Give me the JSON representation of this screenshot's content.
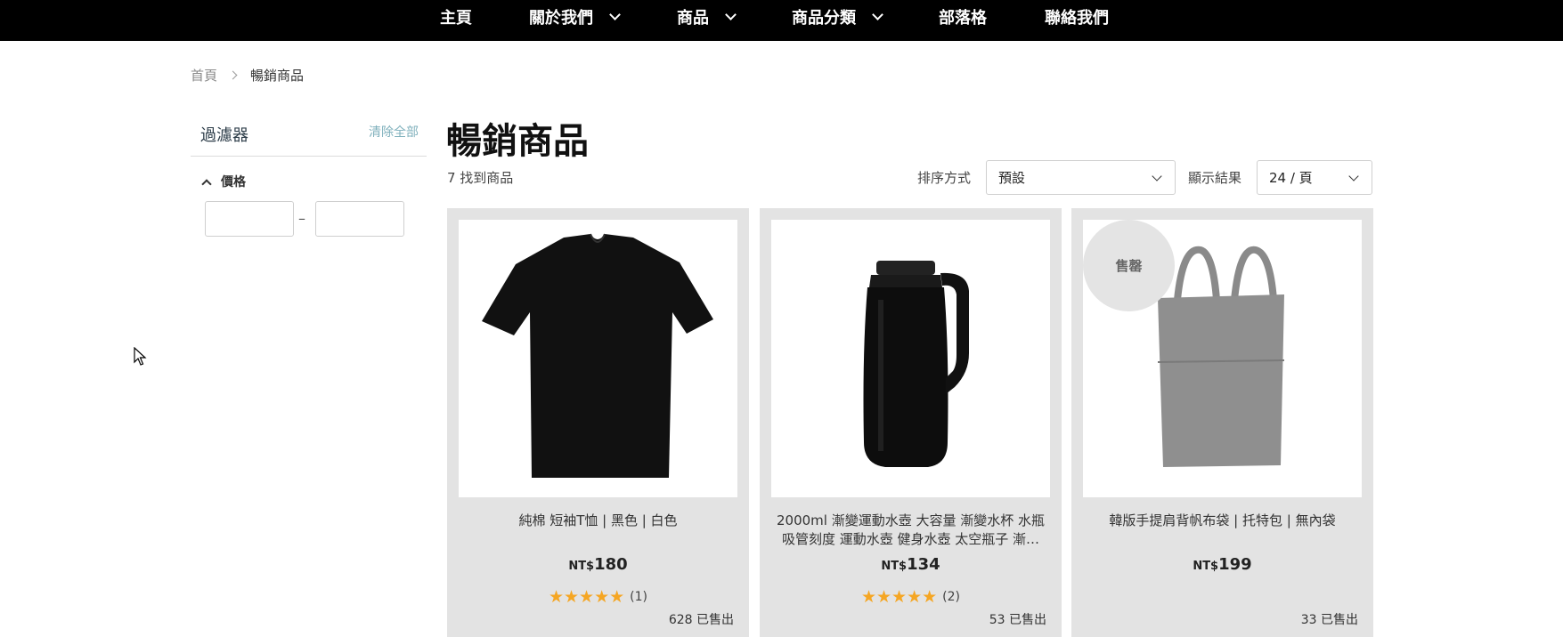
{
  "nav": {
    "items": [
      {
        "label": "主頁",
        "has_dropdown": false
      },
      {
        "label": "關於我們",
        "has_dropdown": true
      },
      {
        "label": "商品",
        "has_dropdown": true
      },
      {
        "label": "商品分類",
        "has_dropdown": true
      },
      {
        "label": "部落格",
        "has_dropdown": false
      },
      {
        "label": "聯絡我們",
        "has_dropdown": false
      }
    ]
  },
  "breadcrumb": {
    "home": "首頁",
    "current": "暢銷商品"
  },
  "filter": {
    "title": "過濾器",
    "clear_all": "清除全部",
    "price_label": "價格",
    "price_min": "",
    "price_max": "",
    "dash": "–"
  },
  "main": {
    "title": "暢銷商品",
    "result_count": "7 找到商品",
    "sort_label": "排序方式",
    "sort_value": "預設",
    "per_page_label": "顯示結果",
    "per_page_value": "24 / 頁"
  },
  "products": [
    {
      "name": "純棉 短袖T恤 | 黑色 | 白色",
      "currency": "NT$",
      "price": "180",
      "rating": 5,
      "review_count": "(1)",
      "sold": "628 已售出",
      "badge": ""
    },
    {
      "name": "2000ml 漸變運動水壺 大容量 漸變水杯 水瓶 吸管刻度 運動水壺 健身水壺 太空瓶子 漸…",
      "currency": "NT$",
      "price": "134",
      "rating": 5,
      "review_count": "(2)",
      "sold": "53 已售出",
      "badge": ""
    },
    {
      "name": "韓版手提肩背帆布袋 | 托特包 | 無內袋",
      "currency": "NT$",
      "price": "199",
      "rating": null,
      "review_count": "",
      "sold": "33 已售出",
      "badge": "售罄"
    }
  ],
  "colors": {
    "nav_bg": "#000000",
    "card_bg": "#e3e3e3",
    "star": "#f5a623",
    "clear_link": "#7fb0bc"
  }
}
